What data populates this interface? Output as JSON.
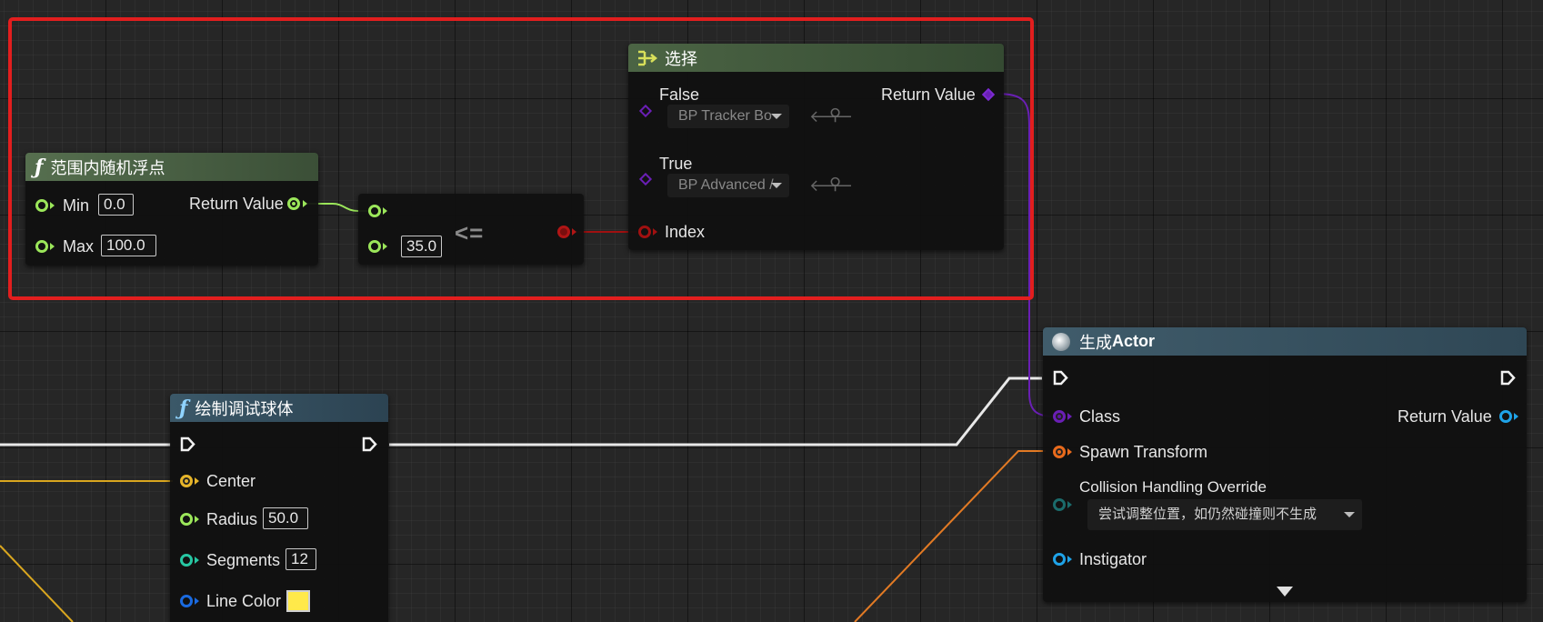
{
  "random_float_node": {
    "title": "范围内随机浮点",
    "min_label": "Min",
    "min_value": "0.0",
    "max_label": "Max",
    "max_value": "100.0",
    "return_label": "Return Value"
  },
  "compare_node": {
    "operator": "<=",
    "b_value": "35.0"
  },
  "select_node": {
    "title": "选择",
    "false_label": "False",
    "false_value": "BP Tracker Bo",
    "true_label": "True",
    "true_value": "BP Advanced /",
    "index_label": "Index",
    "return_label": "Return Value"
  },
  "spawn_actor_node": {
    "title_prefix": "生成",
    "title_bold": "Actor",
    "class_label": "Class",
    "return_label": "Return Value",
    "spawn_transform_label": "Spawn Transform",
    "collision_label": "Collision Handling Override",
    "collision_value": "尝试调整位置，如仍然碰撞则不生成",
    "instigator_label": "Instigator"
  },
  "draw_sphere_node": {
    "title": "绘制调试球体",
    "center_label": "Center",
    "radius_label": "Radius",
    "radius_value": "50.0",
    "segments_label": "Segments",
    "segments_value": "12",
    "line_color_label": "Line Color"
  },
  "colors": {
    "selection": "#e21e1e",
    "float_pin": "#9be65a",
    "bool_pin": "#b01515",
    "wildcard_pin": "#6a1fb5",
    "struct_pin": "#e86a1c",
    "vector_pin": "#e6b52a",
    "object_pin": "#1fa3e8",
    "line_color_swatch": "#ffe94a"
  },
  "icons": [
    "function-icon",
    "select-icon",
    "spawn-icon",
    "exec-pin-icon",
    "dropdown-caret-icon",
    "use-selected-icon",
    "browse-icon",
    "expand-arrow-icon"
  ]
}
